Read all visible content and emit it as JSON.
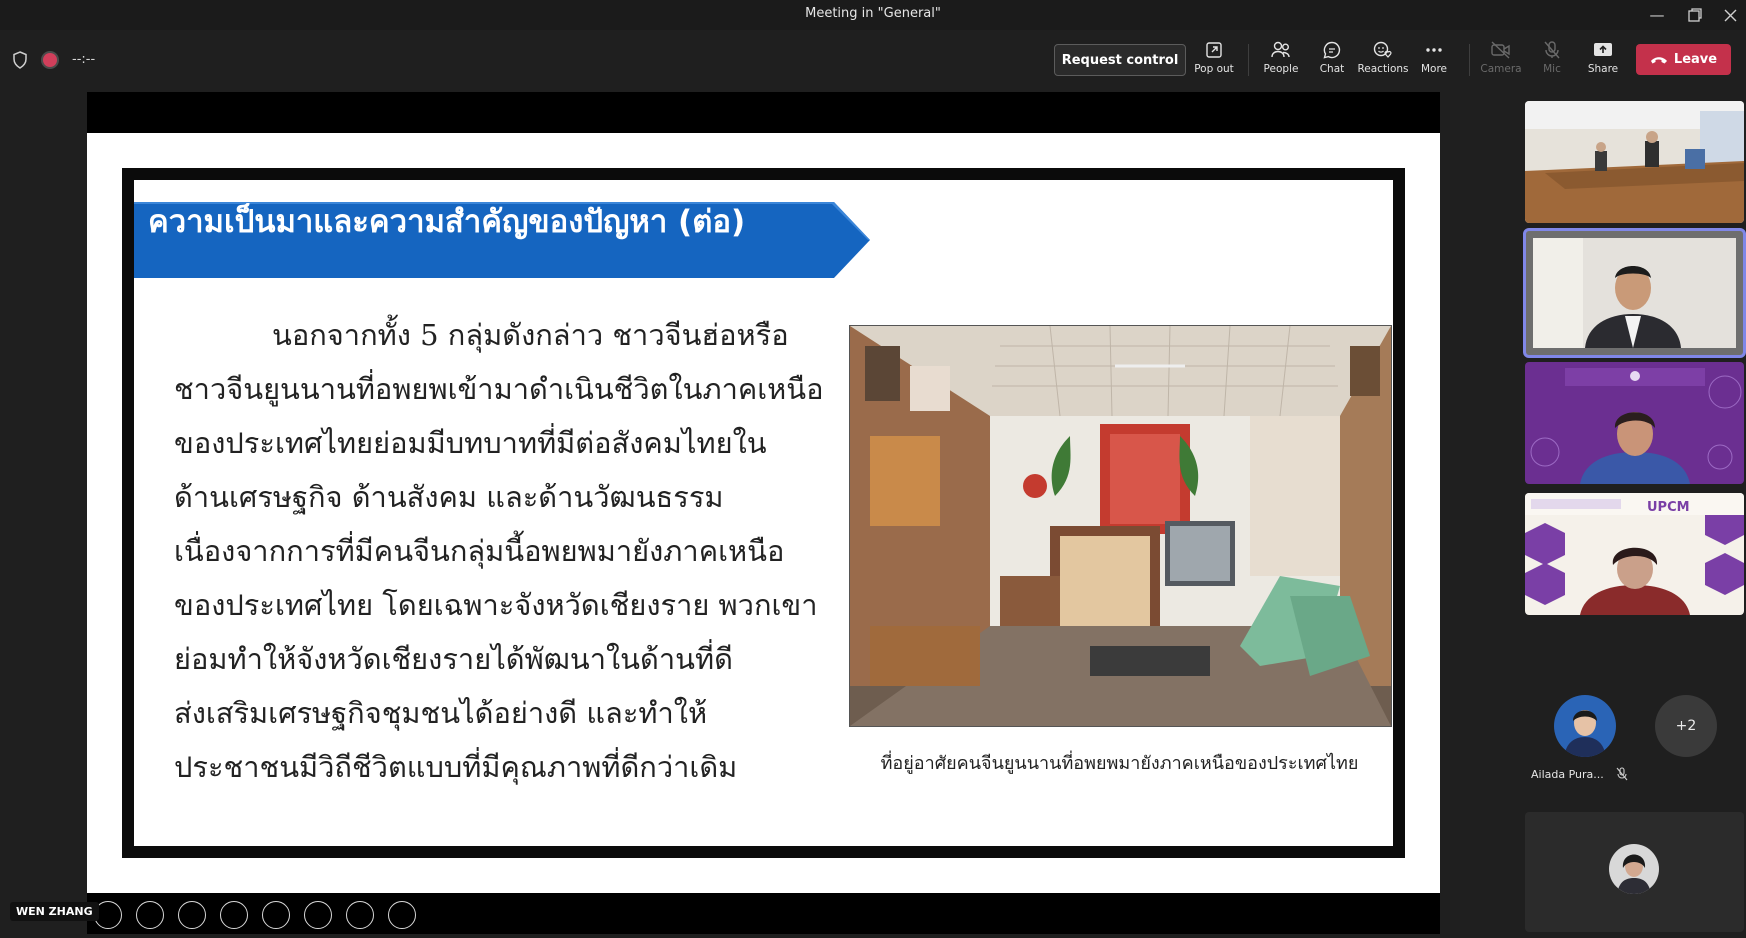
{
  "window": {
    "title": "Meeting in \"General\""
  },
  "toolbar": {
    "timer": "--:--",
    "request_control": "Request control",
    "buttons": [
      {
        "label": "Pop out",
        "icon": "pop-out-icon",
        "enabled": true
      },
      {
        "label": "People",
        "icon": "people-icon",
        "enabled": true
      },
      {
        "label": "Chat",
        "icon": "chat-icon",
        "enabled": true
      },
      {
        "label": "Reactions",
        "icon": "reactions-icon",
        "enabled": true
      },
      {
        "label": "More",
        "icon": "more-icon",
        "enabled": true
      },
      {
        "label": "Camera",
        "icon": "camera-off-icon",
        "enabled": false
      },
      {
        "label": "Mic",
        "icon": "mic-off-icon",
        "enabled": false
      },
      {
        "label": "Share",
        "icon": "share-icon",
        "enabled": true
      }
    ],
    "leave": "Leave",
    "leave_color": "#c4314b"
  },
  "slide": {
    "heading": "ความเป็นมาและความสำคัญของปัญหา (ต่อ)",
    "lines": [
      "นอกจากทั้ง 5 กลุ่มดังกล่าว ชาวจีนฮ่อหรือ",
      "ชาวจีนยูนนานที่อพยพเข้ามาดำเนินชีวิตในภาคเหนือ",
      "ของประเทศไทยย่อมมีบทบาทที่มีต่อสังคมไทยใน",
      "ด้านเศรษฐกิจ ด้านสังคม และด้านวัฒนธรรม",
      "เนื่องจากการที่มีคนจีนกลุ่มนี้อพยพมายังภาคเหนือ",
      "ของประเทศไทย โดยเฉพาะจังหวัดเชียงราย พวกเขา",
      "ย่อมทำให้จังหวัดเชียงรายได้พัฒนาในด้านที่ดี",
      "ส่งเสริมเศรษฐกิจชุมชนได้อย่างดี และทำให้",
      "ประชาชนมีวิถีชีวิตแบบที่มีคุณภาพที่ดีกว่าเดิม"
    ],
    "caption": "ที่อยู่อาศัยคนจีนยูนนานที่อพยพมายังภาคเหนือของประเทศไทย",
    "banner_color": "#1565c0"
  },
  "presenter": {
    "name": "WEN ZHANG"
  },
  "sidebar": {
    "tile3": {
      "logo_text": "UPCM"
    },
    "more_count": "+2",
    "participant_name": "Ailada Pura..."
  }
}
